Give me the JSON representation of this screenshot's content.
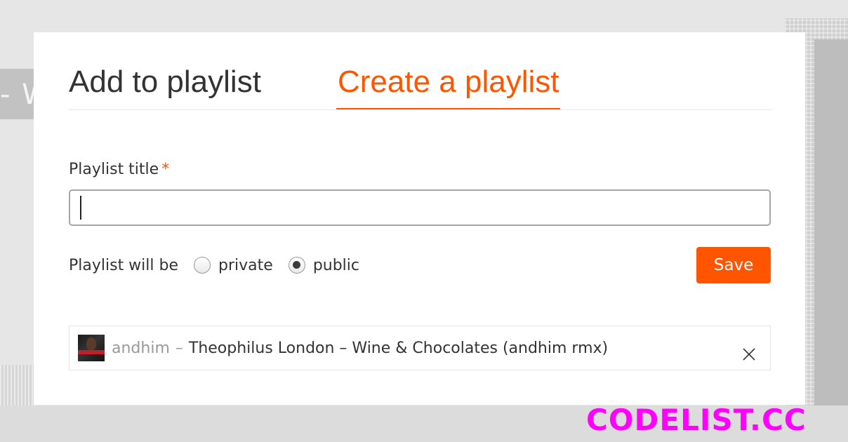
{
  "background": {
    "partial_text": "- W"
  },
  "modal": {
    "tabs": [
      {
        "label": "Add to playlist",
        "active": false
      },
      {
        "label": "Create a playlist",
        "active": true
      }
    ],
    "form": {
      "title_label": "Playlist title",
      "required_marker": "*",
      "title_value": "",
      "privacy_label": "Playlist will be",
      "privacy_options": [
        {
          "label": "private",
          "checked": false
        },
        {
          "label": "public",
          "checked": true
        }
      ],
      "save_label": "Save"
    },
    "tracks": [
      {
        "user": "andhim",
        "separator": "–",
        "title": "Theophilus London – Wine & Chocolates (andhim rmx)",
        "artwork_icon": "album-artwork",
        "remove_icon": "close-icon"
      }
    ]
  },
  "watermark": "CODELIST.CC",
  "colors": {
    "accent": "#ff5500",
    "text": "#333333",
    "muted": "#999999",
    "watermark": "#ff00ff"
  }
}
